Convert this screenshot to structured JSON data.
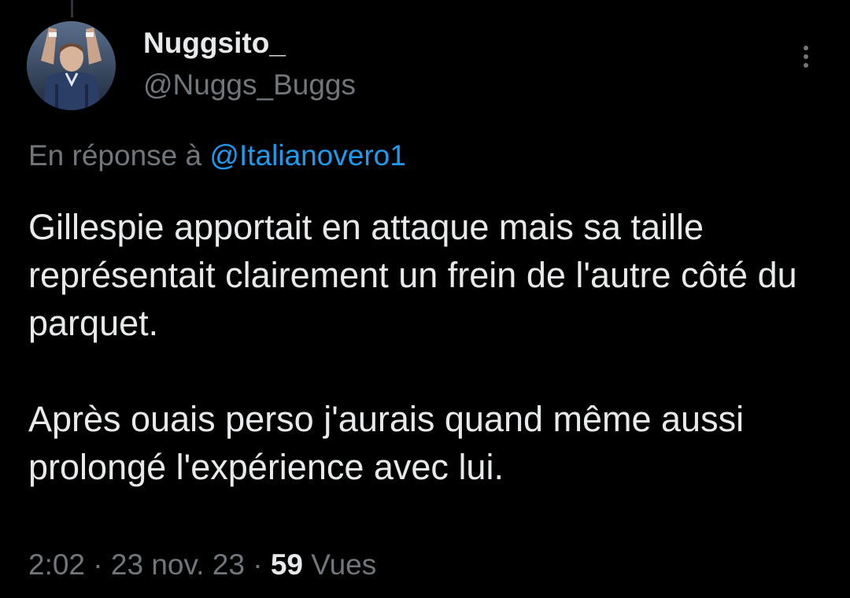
{
  "author": {
    "display_name": "Nuggsito_",
    "handle": "@Nuggs_Buggs"
  },
  "reply_context": {
    "prefix": "En réponse à",
    "mention": "@Italianovero1"
  },
  "tweet": {
    "paragraphs": [
      "Gillespie apportait en attaque mais sa taille représentait clairement un frein de l'autre côté du parquet.",
      "Après ouais perso j'aurais quand même aussi prolongé l'expérience avec lui."
    ]
  },
  "meta": {
    "time": "2:02",
    "separator": "·",
    "date": "23 nov. 23",
    "views_count": "59",
    "views_label": "Vues"
  },
  "icons": {
    "more": "more-vertical-icon",
    "avatar": "profile-photo"
  },
  "colors": {
    "background": "#000000",
    "primary_text": "#e7e9ea",
    "secondary_text": "#71767b",
    "link": "#1d9bf0"
  }
}
